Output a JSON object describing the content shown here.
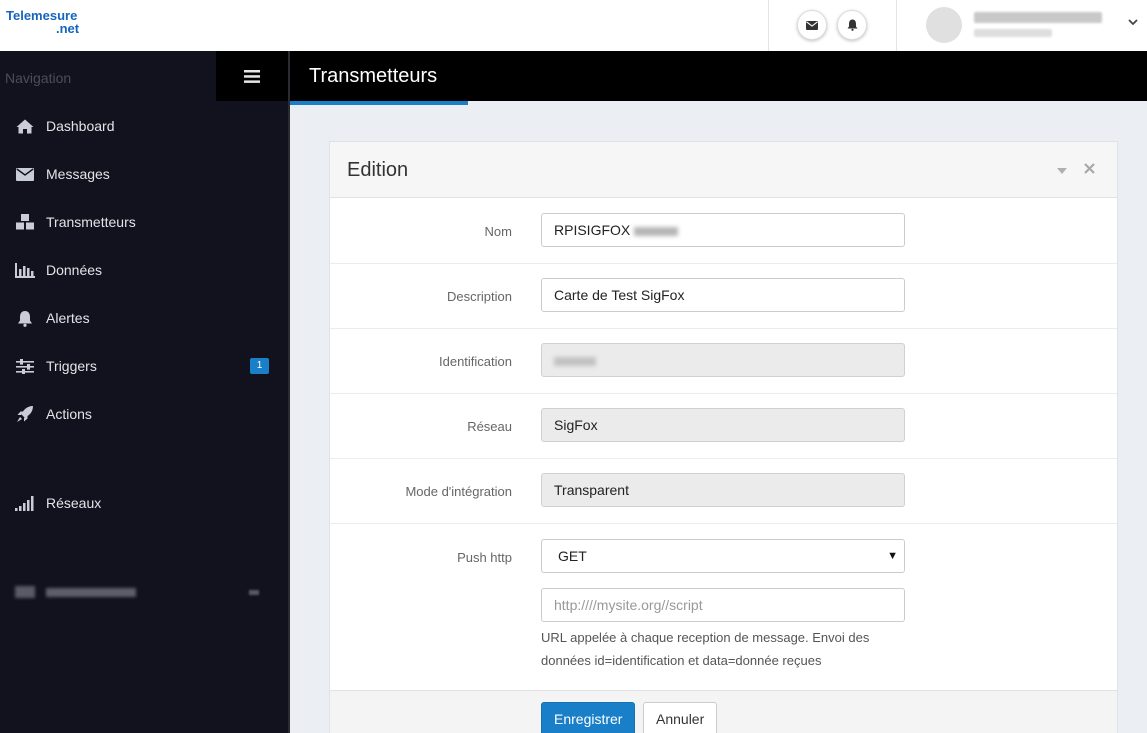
{
  "logo": {
    "line1": "Telemesure",
    "line2": ".net"
  },
  "topbar": {
    "mail_icon": "envelope-icon",
    "bell_icon": "bell-icon",
    "user_menu_icon": "chevron-down-icon"
  },
  "sidebar": {
    "title": "Navigation",
    "toggle_icon": "hamburger-icon",
    "items": [
      {
        "label": "Dashboard",
        "icon": "home-icon"
      },
      {
        "label": "Messages",
        "icon": "envelope-icon"
      },
      {
        "label": "Transmetteurs",
        "icon": "cubes-icon"
      },
      {
        "label": "Données",
        "icon": "bar-chart-icon"
      },
      {
        "label": "Alertes",
        "icon": "bell-icon"
      },
      {
        "label": "Triggers",
        "icon": "sliders-icon",
        "badge": "1"
      },
      {
        "label": "Actions",
        "icon": "rocket-icon"
      },
      {
        "label": "Réseaux",
        "icon": "signal-icon"
      }
    ]
  },
  "header": {
    "title": "Transmetteurs"
  },
  "panel": {
    "title": "Edition",
    "fields": {
      "nom": {
        "label": "Nom",
        "value": "RPISIGFOX"
      },
      "description": {
        "label": "Description",
        "value": "Carte de Test SigFox"
      },
      "identification": {
        "label": "Identification"
      },
      "reseau": {
        "label": "Réseau",
        "value": "SigFox"
      },
      "mode": {
        "label": "Mode d'intégration",
        "value": "Transparent"
      },
      "push": {
        "label": "Push http",
        "method": "GET",
        "url_placeholder": "http:////mysite.org//script",
        "help_line1": "URL appelée à chaque reception de message. Envoi des",
        "help_line2": "données id=identification et data=donnée reçues"
      }
    },
    "buttons": {
      "save": "Enregistrer",
      "cancel": "Annuler"
    }
  },
  "colors": {
    "accent": "#1a7fc9",
    "sidebar_bg": "#12121e",
    "header_bg": "#000000"
  }
}
